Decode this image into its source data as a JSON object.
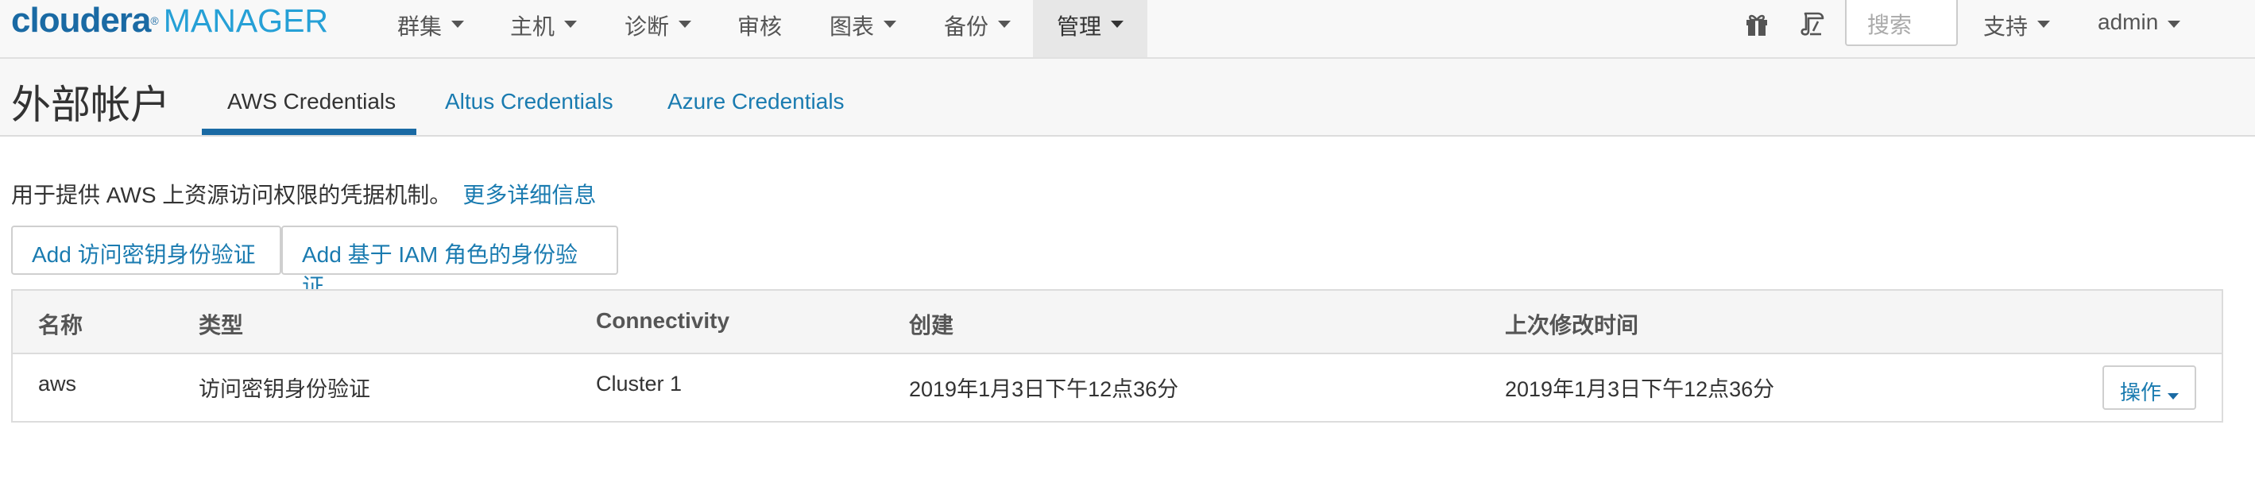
{
  "brand": {
    "name": "cloudera",
    "reg": "®",
    "product": "MANAGER"
  },
  "nav": {
    "items": [
      {
        "label": "群集",
        "has_caret": true
      },
      {
        "label": "主机",
        "has_caret": true
      },
      {
        "label": "诊断",
        "has_caret": true
      },
      {
        "label": "审核",
        "has_caret": false
      },
      {
        "label": "图表",
        "has_caret": true
      },
      {
        "label": "备份",
        "has_caret": true
      },
      {
        "label": "管理",
        "has_caret": true,
        "active": true
      }
    ],
    "tools": {
      "gift_icon": "gift-icon",
      "wrench_icon": "running-commands-icon"
    },
    "search_placeholder": "搜索",
    "support_label": "支持",
    "user_label": "admin"
  },
  "page": {
    "title": "外部帐户",
    "tabs": [
      {
        "label": "AWS Credentials",
        "active": true
      },
      {
        "label": "Altus Credentials",
        "active": false
      },
      {
        "label": "Azure Credentials",
        "active": false
      }
    ]
  },
  "content": {
    "description": "用于提供 AWS 上资源访问权限的凭据机制。",
    "more_link": "更多详细信息",
    "add_access_key_button": "Add 访问密钥身份验证",
    "add_iam_button": "Add 基于 IAM 角色的身份验证"
  },
  "table": {
    "columns": [
      "名称",
      "类型",
      "Connectivity",
      "创建",
      "上次修改时间"
    ],
    "rows": [
      {
        "name": "aws",
        "type": "访问密钥身份验证",
        "connectivity": "Cluster 1",
        "created": "2019年1月3日下午12点36分",
        "modified": "2019年1月3日下午12点36分",
        "actions_label": "操作"
      }
    ]
  },
  "colors": {
    "brand_dark": "#1a6aa4",
    "brand_light": "#26a0d6",
    "link": "#1a7bb0"
  }
}
